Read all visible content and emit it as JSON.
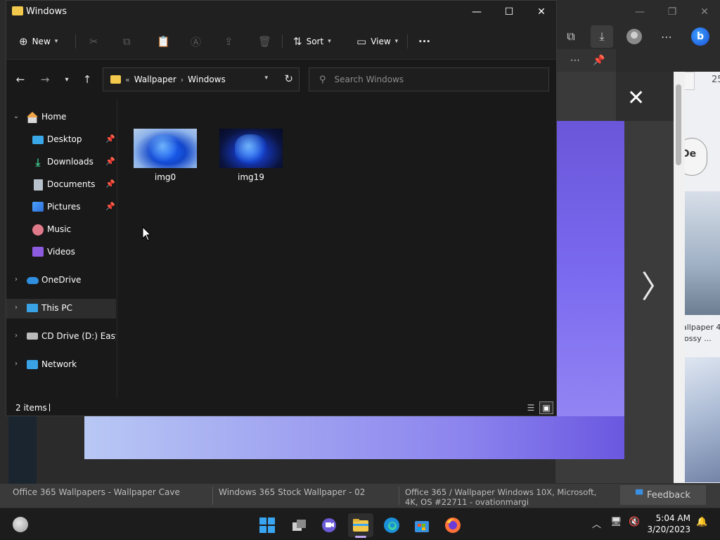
{
  "explorer": {
    "title": "Windows",
    "commands": {
      "new": "New",
      "sort": "Sort",
      "view": "View"
    },
    "address": {
      "overflow": "«",
      "crumbs": [
        "Wallpaper",
        "Windows"
      ]
    },
    "search_placeholder": "Search Windows",
    "sidebar": {
      "home": "Home",
      "desktop": "Desktop",
      "downloads": "Downloads",
      "documents": "Documents",
      "pictures": "Pictures",
      "music": "Music",
      "videos": "Videos",
      "onedrive": "OneDrive",
      "this_pc": "This PC",
      "cd_drive": "CD Drive (D:) EasyKMS",
      "network": "Network"
    },
    "files": [
      {
        "name": "img0"
      },
      {
        "name": "img19"
      }
    ],
    "status": "2 items"
  },
  "browser": {
    "bottom_items": [
      "Office 365 Wallpapers - Wallpaper Cave",
      "Windows 365 Stock Wallpaper - 02",
      "Office 365 / Wallpaper Windows 10X, Microsoft, 4K, OS #22711 - ovationmargi"
    ],
    "feedback": "Feedback",
    "right_text_1": "allpaper 4",
    "right_text_2": "lossy ...",
    "right_pill": "De",
    "right_count": "25"
  },
  "taskbar": {
    "time": "5:04 AM",
    "date": "3/20/2023"
  },
  "colors": {
    "accent": "#3aa6f2",
    "folder": "#f2c94c",
    "viewer_purple": "#7a6af0"
  }
}
